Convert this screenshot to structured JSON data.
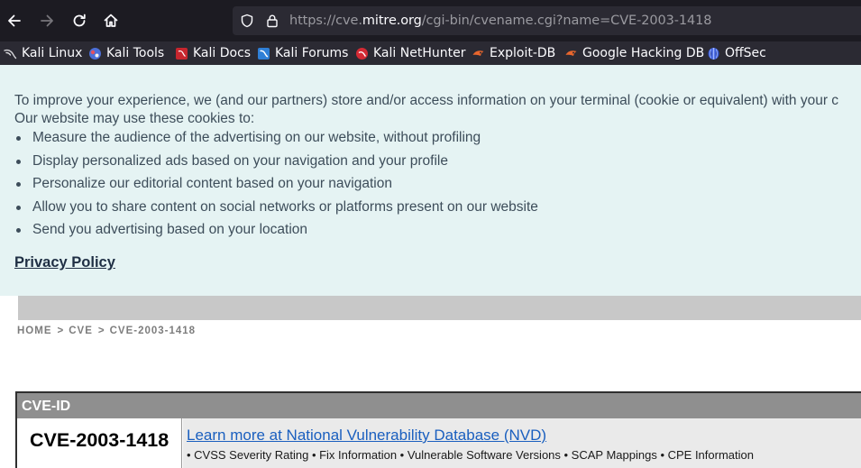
{
  "browser": {
    "url_prefix": "https://cve.",
    "url_host": "mitre.org",
    "url_path": "/cgi-bin/cvename.cgi?name=CVE-2003-1418",
    "bookmarks": [
      {
        "label": "Kali Linux",
        "icon": "kali-dragon-icon"
      },
      {
        "label": "Kali Tools",
        "icon": "kali-tools-icon"
      },
      {
        "label": "Kali Docs",
        "icon": "kali-docs-icon"
      },
      {
        "label": "Kali Forums",
        "icon": "kali-forums-icon"
      },
      {
        "label": "Kali NetHunter",
        "icon": "nethunter-icon"
      },
      {
        "label": "Exploit-DB",
        "icon": "exploit-db-icon"
      },
      {
        "label": "Google Hacking DB",
        "icon": "ghdb-icon"
      },
      {
        "label": "OffSec",
        "icon": "offsec-icon"
      }
    ]
  },
  "cookie_banner": {
    "intro": "To improve your experience, we (and our partners) store and/or access information on your terminal (cookie or equivalent) with your c",
    "subtitle": "Our website may use these cookies to:",
    "items": [
      "Measure the audience of the advertising on our website, without profiling",
      "Display personalized ads based on your navigation and your profile",
      "Personalize our editorial content based on your navigation",
      "Allow you to share content on social networks or platforms present on our website",
      "Send you advertising based on your location"
    ],
    "privacy_link": "Privacy Policy"
  },
  "breadcrumb": {
    "home": "HOME",
    "sep": ">",
    "cve": "CVE",
    "current": "CVE-2003-1418"
  },
  "cve_record": {
    "header": "CVE-ID",
    "id": "CVE-2003-1418",
    "nvd_link": "Learn more at National Vulnerability Database (NVD)",
    "nvd_details": "• CVSS Severity Rating • Fix Information • Vulnerable Software Versions • SCAP Mappings • CPE Information"
  },
  "colors": {
    "browser_toolbar": "#1c1b22",
    "bookmarks_bar": "#2b2a33",
    "cookie_bg": "#e5f3f3",
    "link_blue": "#1a5fbf",
    "table_header": "#8f8f8f"
  }
}
